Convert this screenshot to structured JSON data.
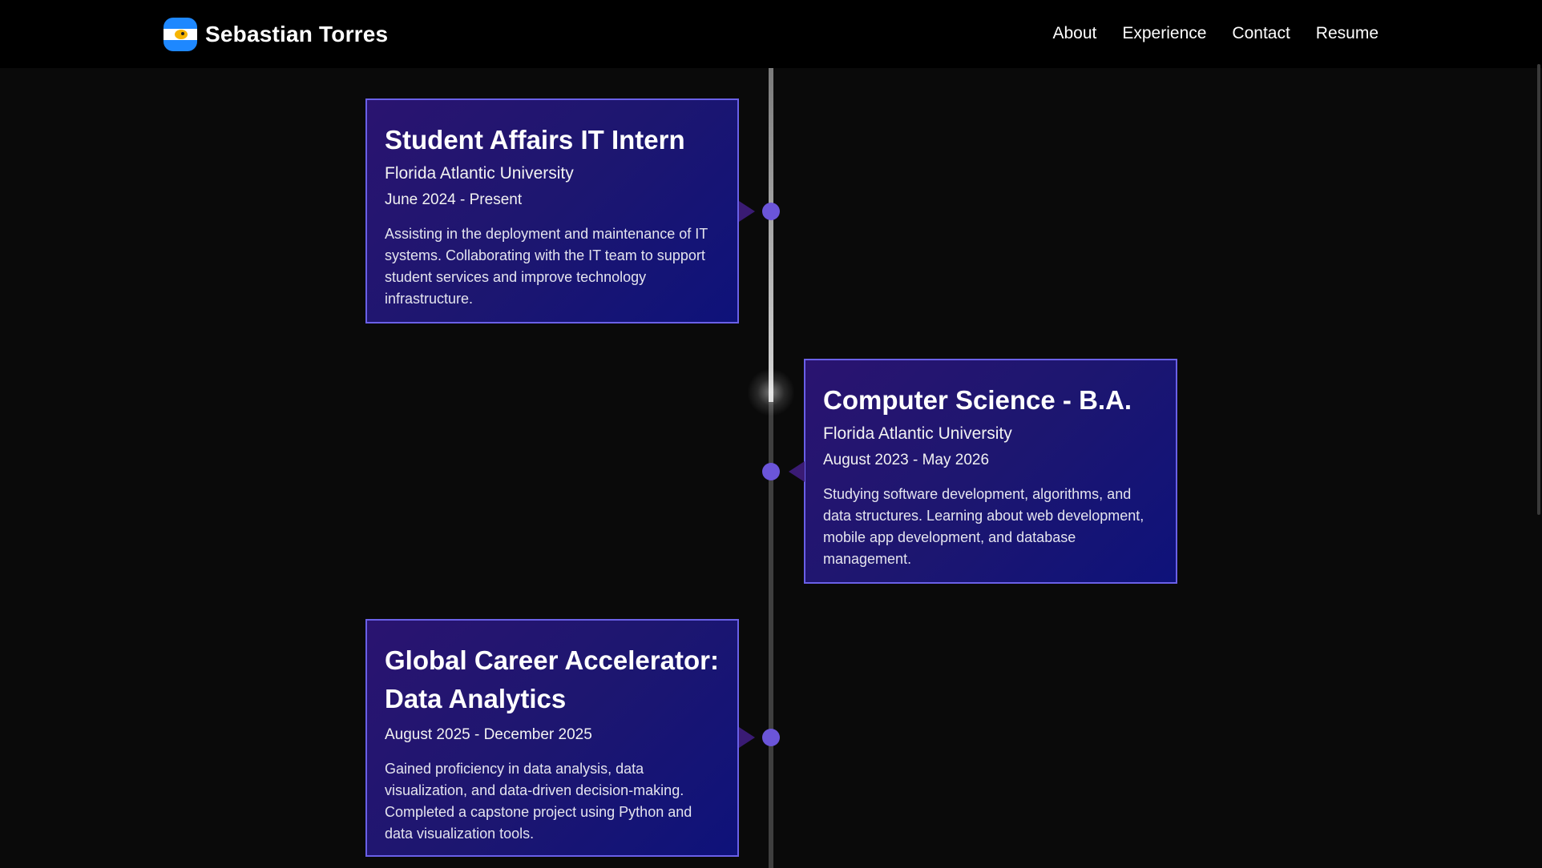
{
  "header": {
    "brand_name": "Sebastian Torres",
    "logo_icon": "flag-logo-icon",
    "nav": [
      "About",
      "Experience",
      "Contact",
      "Resume"
    ]
  },
  "colors": {
    "background": "#0a0a0a",
    "navbar": "#000000",
    "card_border": "#6a60e8",
    "card_gradient_start": "#2a1470",
    "card_gradient_end": "#0e127a",
    "timeline_dot": "#6b55d9"
  },
  "timeline": {
    "entries": [
      {
        "title": "Student Affairs IT Intern",
        "organization": "Florida Atlantic University",
        "date": "June 2024 - Present",
        "description": "Assisting in the deployment and maintenance of IT systems. Collaborating with the IT team to support student services and improve technology infrastructure."
      },
      {
        "title": "Computer Science - B.A.",
        "organization": "Florida Atlantic University",
        "date": "August 2023 - May 2026",
        "description": "Studying software development, algorithms, and data structures. Learning about web development, mobile app development, and database management."
      },
      {
        "title": "Global Career Accelerator: Data Analytics",
        "organization": "",
        "date": "August 2025 - December 2025",
        "description": "Gained proficiency in data analysis, data visualization, and data-driven decision-making. Completed a capstone project using Python and data visualization tools."
      }
    ]
  }
}
